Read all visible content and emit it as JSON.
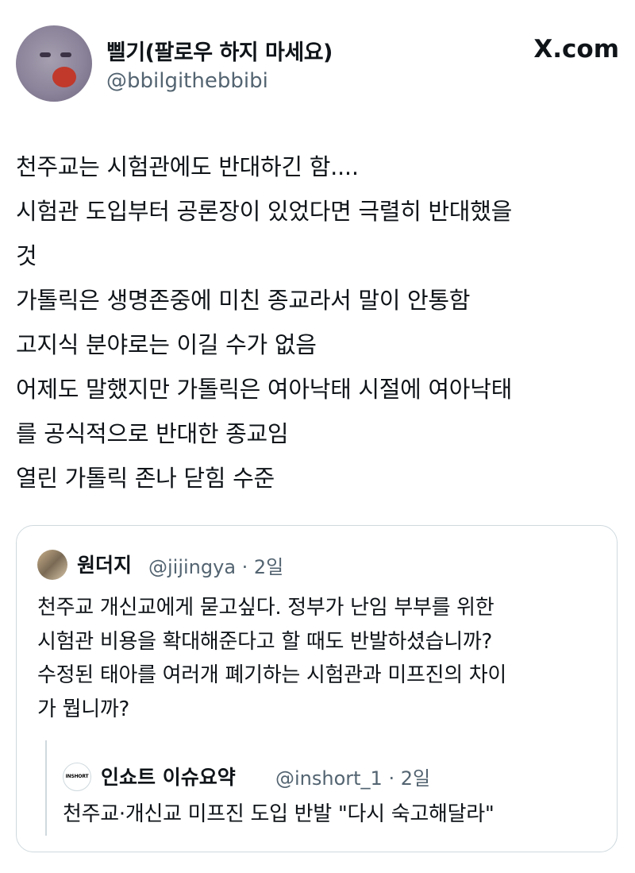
{
  "author": {
    "name": "삘기(팔로우 하지 마세요)",
    "handle": "@bbilgithebbibi"
  },
  "site_label": "X.com",
  "tweet": {
    "lines": [
      "천주교는 시험관에도 반대하긴 함....",
      "시험관 도입부터 공론장이 있었다면 극렬히 반대했을",
      "것",
      "가톨릭은 생명존중에 미친 종교라서 말이 안통함",
      "고지식 분야로는 이길 수가 없음",
      "어제도 말했지만 가톨릭은 여아낙태 시절에 여아낙태",
      "를 공식적으로 반대한 종교임",
      "열린 가톨릭 존나 닫힘 수준"
    ]
  },
  "quoted": {
    "name": "원더지",
    "handle_time": "@jijingya · 2일",
    "lines": [
      "천주교 개신교에게 묻고싶다. 정부가 난임 부부를 위한",
      "시험관 비용을 확대해준다고 할 때도 반발하셨습니까?",
      "수정된 태아를 여러개 폐기하는 시험관과 미프진의 차이",
      "가 뭡니까?"
    ],
    "nested": {
      "logo_text": "INSHORT",
      "name": "인쇼트 이슈요약",
      "handle_time": "@inshort_1 · 2일",
      "text": "천주교·개신교 미프진 도입 반발 \"다시 숙고해달라\""
    }
  }
}
